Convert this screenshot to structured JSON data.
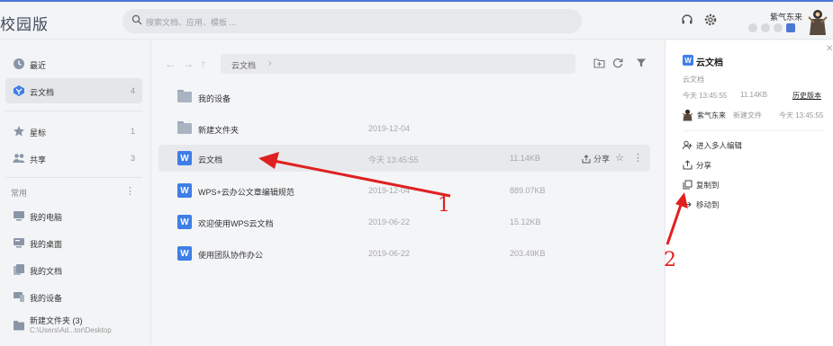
{
  "header": {
    "brand": "校园版",
    "search_placeholder": "搜索文档、应用、模板 ...",
    "user_name": "紫气东来"
  },
  "sidebar": {
    "items": [
      {
        "label": "最近",
        "count": "",
        "icon": "clock-icon"
      },
      {
        "label": "云文档",
        "count": "4",
        "icon": "cloud-doc-icon"
      },
      {
        "label": "星标",
        "count": "1",
        "icon": "star-icon"
      },
      {
        "label": "共享",
        "count": "3",
        "icon": "share-users-icon"
      }
    ],
    "section_title": "常用",
    "section_more": "⋮",
    "common": [
      {
        "label": "我的电脑"
      },
      {
        "label": "我的桌面"
      },
      {
        "label": "我的文档"
      },
      {
        "label": "我的设备"
      },
      {
        "label": "新建文件夹 (3)",
        "sub": "C:\\Users\\Ad...tor\\Desktop"
      }
    ]
  },
  "main": {
    "breadcrumb": "云文档",
    "files": [
      {
        "name": "我的设备",
        "date": "",
        "size": "",
        "type": "folder"
      },
      {
        "name": "新建文件夹",
        "date": "2019-12-04",
        "size": "",
        "type": "folder"
      },
      {
        "name": "云文档",
        "date": "今天 13:45:55",
        "size": "11.14KB",
        "type": "doc",
        "share": "分享"
      },
      {
        "name": "WPS+云办公文章编辑规范",
        "date": "2019-12-04",
        "size": "889.07KB",
        "type": "doc"
      },
      {
        "name": "欢迎使用WPS云文档",
        "date": "2019-06-22",
        "size": "15.12KB",
        "type": "doc"
      },
      {
        "name": "使用团队协作办公",
        "date": "2019-06-22",
        "size": "203.49KB",
        "type": "doc"
      }
    ]
  },
  "panel": {
    "title": "云文档",
    "subtitle": "云文档",
    "modified": "今天 13:45:55",
    "size": "11.14KB",
    "history": "历史版本",
    "user": "紫气东来",
    "action": "新建文件",
    "time": "今天 13:45:55",
    "menu": [
      {
        "label": "进入多人编辑",
        "icon": "multi-edit-icon"
      },
      {
        "label": "分享",
        "icon": "share-icon"
      },
      {
        "label": "复制到",
        "icon": "copy-icon"
      },
      {
        "label": "移动到",
        "icon": "move-icon"
      }
    ]
  },
  "annotations": {
    "one": "1",
    "two": "2",
    "color": "#e02020"
  },
  "colors": {
    "accent": "#4a78d4",
    "doc_icon": "#3f7ee6"
  }
}
